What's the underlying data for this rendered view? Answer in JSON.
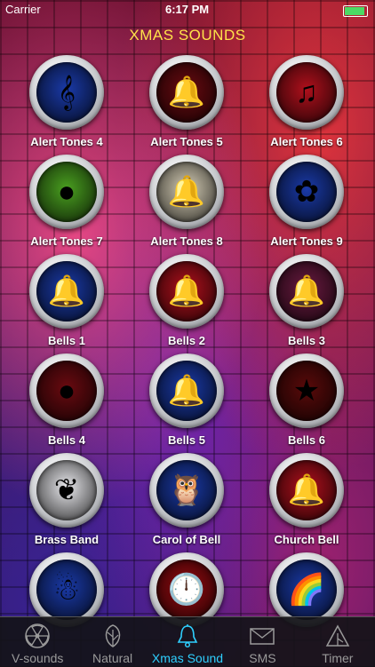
{
  "status_bar": {
    "carrier": "Carrier",
    "time": "6:17 PM"
  },
  "header": {
    "title": "XMAS SOUNDS"
  },
  "sounds": [
    {
      "label": "Alert Tones 4",
      "icon": "treble-clef-icon",
      "glyph": "𝄞",
      "bg": "#1a3aa8"
    },
    {
      "label": "Alert Tones 5",
      "icon": "bells-icon",
      "glyph": "🔔",
      "bg": "#6a0a10"
    },
    {
      "label": "Alert Tones 6",
      "icon": "music-note-icon",
      "glyph": "♫",
      "bg": "#b0101c"
    },
    {
      "label": "Alert Tones 7",
      "icon": "ornament-icon",
      "glyph": "●",
      "bg": "#4aa020"
    },
    {
      "label": "Alert Tones 8",
      "icon": "bells-icon",
      "glyph": "🔔",
      "bg": "#d8d0b8"
    },
    {
      "label": "Alert Tones 9",
      "icon": "flower-icon",
      "glyph": "✿",
      "bg": "#1a3aa8"
    },
    {
      "label": "Bells 1",
      "icon": "bells-icon",
      "glyph": "🔔",
      "bg": "#1a3aa8"
    },
    {
      "label": "Bells 2",
      "icon": "bell-icon",
      "glyph": "🔔",
      "bg": "#b0101c"
    },
    {
      "label": "Bells 3",
      "icon": "bells-icon",
      "glyph": "🔔",
      "bg": "#6a1a40"
    },
    {
      "label": "Bells 4",
      "icon": "ornament-icon",
      "glyph": "●",
      "bg": "#6a0a10"
    },
    {
      "label": "Bells 5",
      "icon": "bells-icon",
      "glyph": "🔔",
      "bg": "#1a3aa8"
    },
    {
      "label": "Bells 6",
      "icon": "star-icon",
      "glyph": "★",
      "bg": "#5a0a0a"
    },
    {
      "label": "Brass Band",
      "icon": "beard-icon",
      "glyph": "❦",
      "bg": "#e8e8ec"
    },
    {
      "label": "Carol of Bell",
      "icon": "owl-icon",
      "glyph": "🦉",
      "bg": "#1a3aa8"
    },
    {
      "label": "Church Bell",
      "icon": "bells-icon",
      "glyph": "🔔",
      "bg": "#b0101c"
    },
    {
      "label": "",
      "icon": "snowman-icon",
      "glyph": "☃",
      "bg": "#1a3aa8"
    },
    {
      "label": "",
      "icon": "clock-icon",
      "glyph": "🕛",
      "bg": "#9a0a10"
    },
    {
      "label": "",
      "icon": "rainbow-icon",
      "glyph": "🌈",
      "bg": "#1a3aa8"
    }
  ],
  "tabbar": {
    "tabs": [
      {
        "label": "V-sounds",
        "icon": "radiation-icon"
      },
      {
        "label": "Natural",
        "icon": "leaf-icon"
      },
      {
        "label": "Xmas Sound",
        "icon": "bell-icon",
        "active": true
      },
      {
        "label": "SMS",
        "icon": "envelope-icon"
      },
      {
        "label": "Timer",
        "icon": "timer-icon"
      }
    ]
  },
  "colors": {
    "title": "#ffe24a",
    "active_tab": "#2fd0ff",
    "inactive_tab": "#9a9a9a"
  }
}
